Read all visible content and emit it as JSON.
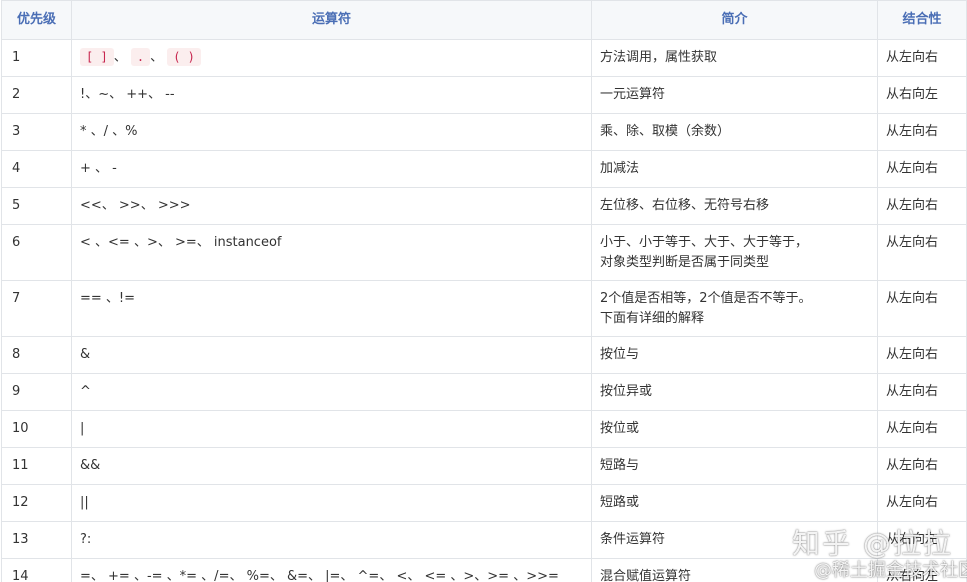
{
  "table": {
    "headers": [
      "优先级",
      "运算符",
      "简介",
      "结合性"
    ],
    "rows": [
      {
        "priority": "1",
        "ops_code": [
          "[ ]",
          ".",
          "( )"
        ],
        "desc": [
          "方法调用，属性获取"
        ],
        "assoc": "从左向右"
      },
      {
        "priority": "2",
        "ops": "!、~、 ++、 --",
        "desc": [
          "一元运算符"
        ],
        "assoc": "从右向左"
      },
      {
        "priority": "3",
        "ops": "* 、/ 、%",
        "desc": [
          "乘、除、取模（余数）"
        ],
        "assoc": "从左向右"
      },
      {
        "priority": "4",
        "ops": "+ 、 -",
        "desc": [
          "加减法"
        ],
        "assoc": "从左向右"
      },
      {
        "priority": "5",
        "ops": "<<、 >>、 >>>",
        "desc": [
          "左位移、右位移、无符号右移"
        ],
        "assoc": "从左向右"
      },
      {
        "priority": "6",
        "ops": "< 、<= 、>、 >=、 instanceof",
        "desc": [
          "小于、小于等于、大于、大于等于，",
          "对象类型判断是否属于同类型"
        ],
        "assoc": "从左向右"
      },
      {
        "priority": "7",
        "ops": "== 、!=",
        "desc": [
          "2个值是否相等，2个值是否不等于。",
          "下面有详细的解释"
        ],
        "assoc": "从左向右"
      },
      {
        "priority": "8",
        "ops": "&",
        "desc": [
          "按位与"
        ],
        "assoc": "从左向右"
      },
      {
        "priority": "9",
        "ops": "^",
        "desc": [
          "按位异或"
        ],
        "assoc": "从左向右"
      },
      {
        "priority": "10",
        "ops": "|",
        "desc": [
          "按位或"
        ],
        "assoc": "从左向右"
      },
      {
        "priority": "11",
        "ops": "&&",
        "desc": [
          "短路与"
        ],
        "assoc": "从左向右"
      },
      {
        "priority": "12",
        "ops": "||",
        "desc": [
          "短路或"
        ],
        "assoc": "从左向右"
      },
      {
        "priority": "13",
        "ops": "?:",
        "desc": [
          "条件运算符"
        ],
        "assoc": "从右向左"
      },
      {
        "priority": "14",
        "ops": "=、 += 、-= 、*= 、/=、 %=、 &=、 |=、 ^=、 <、 <= 、>、>= 、>>=",
        "desc": [
          "混合赋值运算符"
        ],
        "assoc": "从右向左"
      }
    ]
  },
  "watermark": {
    "main": "知乎 @拉拉",
    "sub": "@稀土掘金技术社区"
  }
}
